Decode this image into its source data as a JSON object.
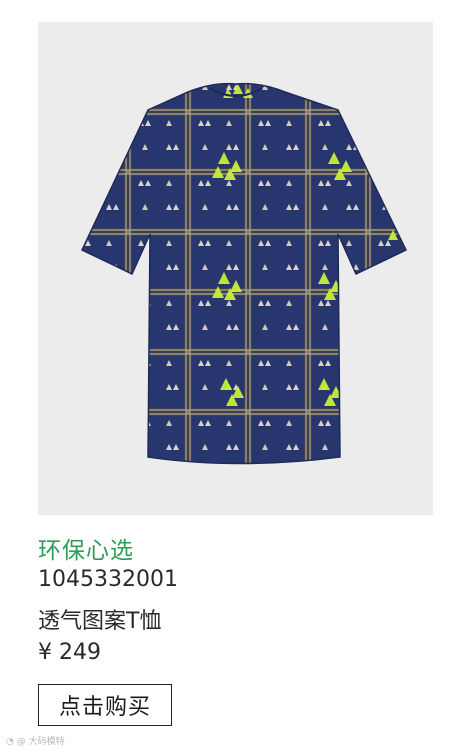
{
  "product": {
    "image_alt": "透气图案T恤",
    "collection": "环保心选",
    "sku": "1045332001",
    "name": "透气图案T恤",
    "price": "¥ 249"
  },
  "actions": {
    "buy_label": "点击购买"
  },
  "watermark": {
    "text": "@ 大码模特"
  },
  "colors": {
    "collection_green": "#2e9b57",
    "shirt_navy": "#27366e",
    "accent_lime": "#c8f03a",
    "image_bg": "#ececec"
  },
  "icons": {
    "watermark_icon": "weibo-logo-icon"
  }
}
